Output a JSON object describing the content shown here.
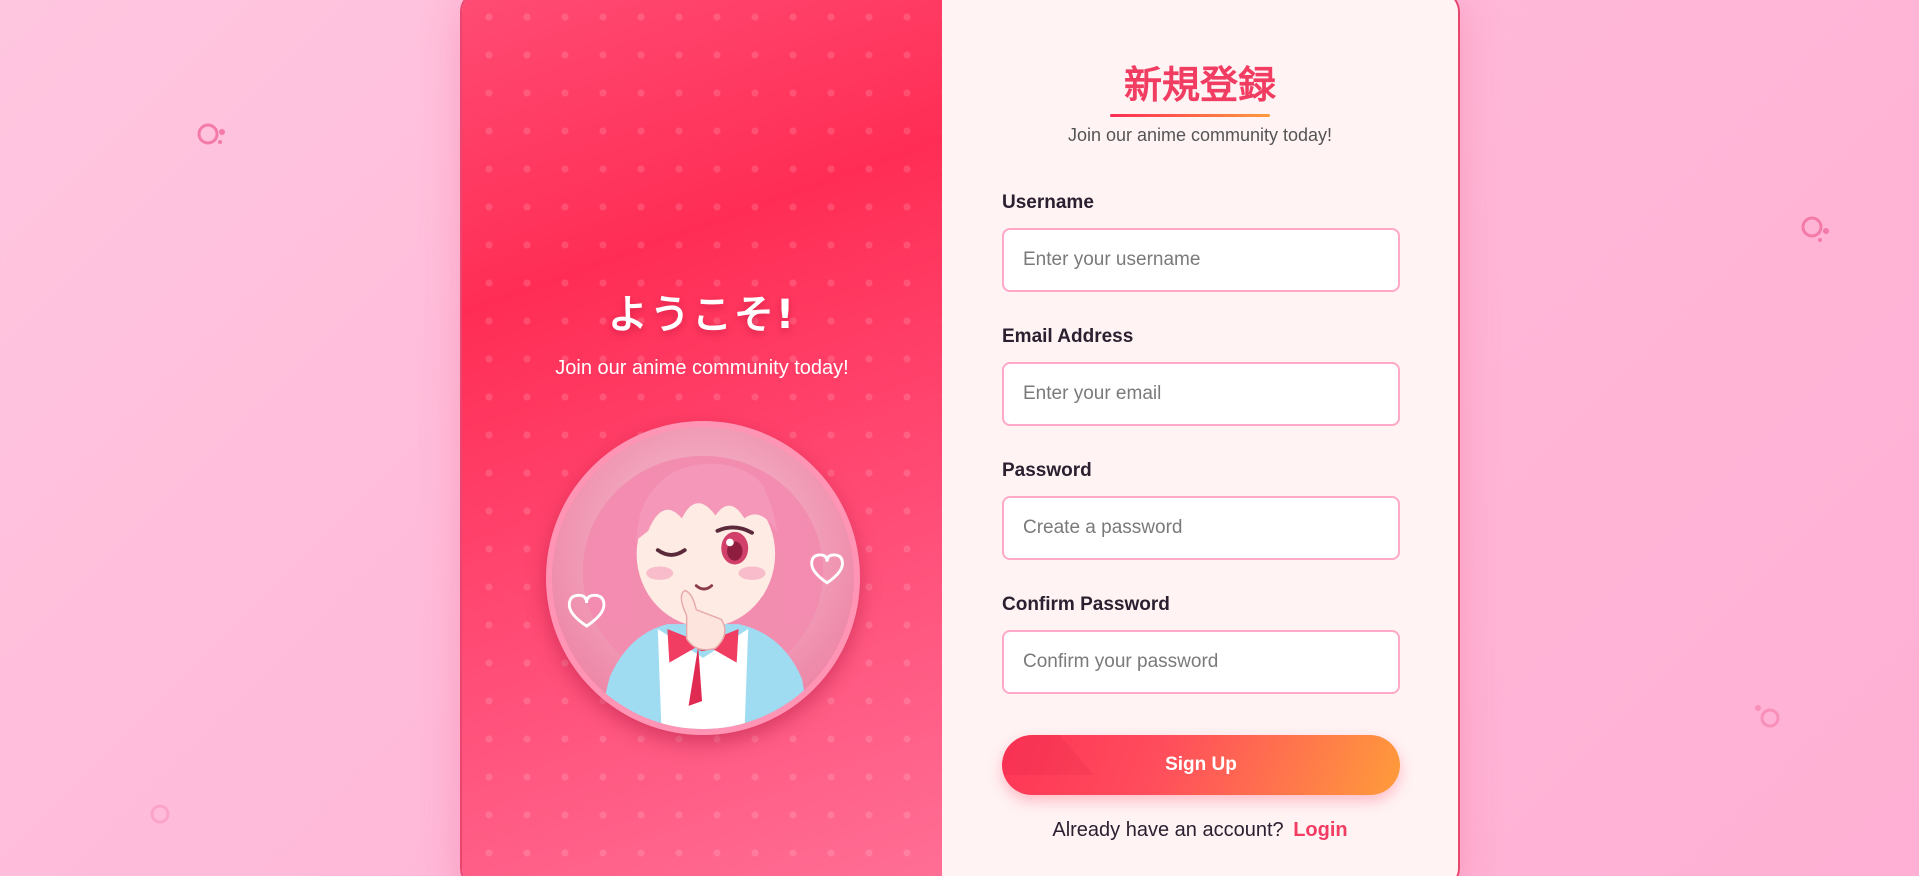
{
  "welcome_panel": {
    "greeting": "ようこそ!",
    "tagline": "Join our anime community today!",
    "avatar_icon": "anime-girl-avatar"
  },
  "form": {
    "title": "新規登録",
    "subtitle": "Join our anime community today!",
    "fields": [
      {
        "label": "Username",
        "placeholder": "Enter your username",
        "value": ""
      },
      {
        "label": "Email Address",
        "placeholder": "Enter your email",
        "value": ""
      },
      {
        "label": "Password",
        "placeholder": "Create a password",
        "value": ""
      },
      {
        "label": "Confirm Password",
        "placeholder": "Confirm your password",
        "value": ""
      }
    ],
    "submit_label": "Sign Up",
    "login_prompt": "Already have an account?",
    "login_link": "Login"
  },
  "colors": {
    "accent": "#f23d63",
    "gradient_start": "#ff2d55",
    "gradient_end": "#ff9a3c",
    "background": "#ffb8d8"
  },
  "decorations": [
    "bubble-icon",
    "bubble-icon",
    "bubble-icon",
    "bubble-icon"
  ]
}
